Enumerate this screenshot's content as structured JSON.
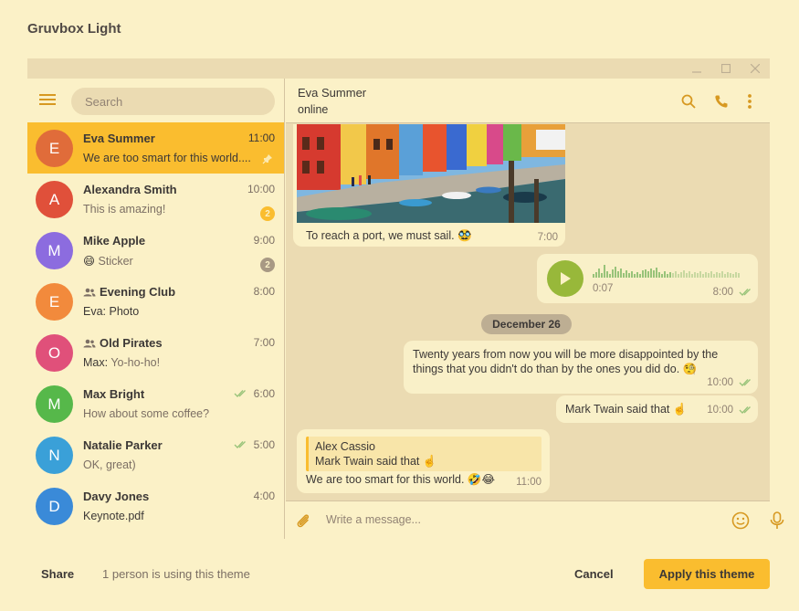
{
  "dialog": {
    "title": "Gruvbox Light",
    "share_label": "Share",
    "users_note": "1 person is using this theme",
    "cancel_label": "Cancel",
    "apply_label": "Apply this theme"
  },
  "colors": {
    "background": "#fbf1c7",
    "panel": "#ebdbb2",
    "accent": "#fabd2f",
    "text": "#3c3836",
    "muted": "#928374",
    "check_green": "#98c379",
    "play_green": "#98b83a"
  },
  "sidebar": {
    "menu_icon": "hamburger-icon",
    "search_placeholder": "Search",
    "chats": [
      {
        "initial": "E",
        "name": "Eva Summer",
        "time": "11:00",
        "preview": "We are too smart for this world....",
        "avatar_color": "#e06c3a",
        "active": true,
        "pinned": true
      },
      {
        "initial": "A",
        "name": "Alexandra Smith",
        "time": "10:00",
        "preview": "This is amazing!",
        "avatar_color": "#e0503a",
        "badge": "2",
        "badge_color": "#fabd2f"
      },
      {
        "initial": "M",
        "name": "Mike Apple",
        "time": "9:00",
        "preview_emoji": "😄",
        "preview": "Sticker",
        "avatar_color": "#8c6cdf",
        "badge": "2",
        "badge_color": "#a89984"
      },
      {
        "initial": "E",
        "name": "Evening Club",
        "time": "8:00",
        "sender": "Eva:",
        "preview": "Photo",
        "avatar_color": "#f28a3c",
        "group": true
      },
      {
        "initial": "O",
        "name": "Old Pirates",
        "time": "7:00",
        "sender": "Max:",
        "preview": "Yo-ho-ho!",
        "avatar_color": "#e0507a",
        "group": true
      },
      {
        "initial": "M",
        "name": "Max Bright",
        "time": "6:00",
        "preview": "How about some coffee?",
        "avatar_color": "#56b84a",
        "read": true
      },
      {
        "initial": "N",
        "name": "Natalie Parker",
        "time": "5:00",
        "preview": "OK, great)",
        "avatar_color": "#3aa0d8",
        "read": true
      },
      {
        "initial": "D",
        "name": "Davy Jones",
        "time": "4:00",
        "preview": "Keynote.pdf",
        "avatar_color": "#3a8ad8",
        "preview_dark": true
      }
    ]
  },
  "chat": {
    "peer_name": "Eva Summer",
    "peer_status": "online",
    "photo_caption": "To reach a port, we must sail. 🥸",
    "photo_time": "7:00",
    "voice_duration": "0:07",
    "voice_time": "8:00",
    "date_separator": "December 26",
    "msg_long": "Twenty years from now you will be more disappointed by the things that you didn't do than by the ones you did do. 🧐",
    "msg_long_time": "10:00",
    "msg_short": "Mark Twain said that ☝️",
    "msg_short_time": "10:00",
    "reply_name": "Alex Cassio",
    "reply_text": "Mark Twain said that ☝️",
    "reply_body": "We are too smart for this world. 🤣😂",
    "reply_time": "11:00",
    "composer_placeholder": "Write a message..."
  }
}
